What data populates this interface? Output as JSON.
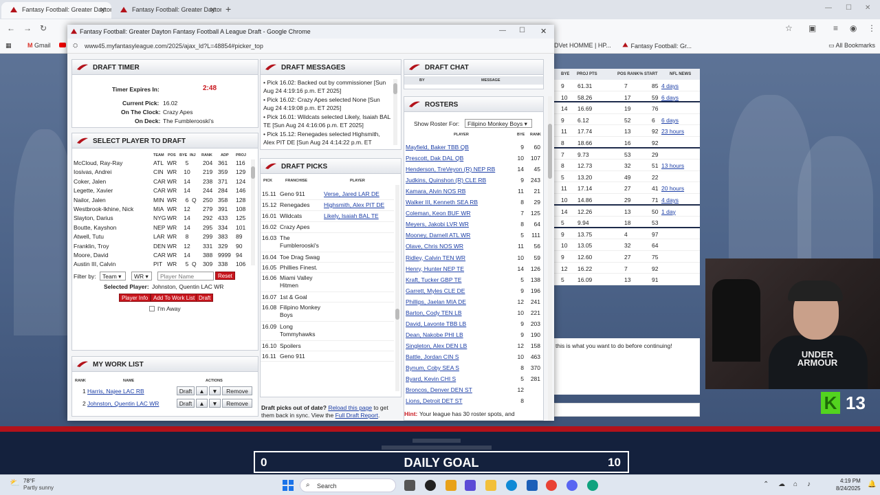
{
  "browser": {
    "tabs": [
      {
        "title": "Fantasy Football: Greater Dayton",
        "active": true
      },
      {
        "title": "Fantasy Football: Greater Dayton",
        "active": false
      }
    ],
    "bookmarks": [
      {
        "label": "Gmail"
      },
      {
        "label": "ADVet HOMME | HP..."
      },
      {
        "label": "Fantasy Football: Gr..."
      },
      {
        "label": "All Bookmarks"
      }
    ]
  },
  "popup": {
    "title": "Fantasy Football: Greater Dayton Fantasy Football A League Draft - Google Chrome",
    "url": "www45.myfantasyleague.com/2025/ajax_ld?L=48854#picker_top"
  },
  "timer": {
    "header": "DRAFT TIMER",
    "expires_label": "Timer Expires In:",
    "expires_value": "2:48",
    "current_label": "Current Pick:",
    "current_value": "16.02",
    "clock_label": "On The Clock:",
    "clock_value": "Crazy Apes",
    "deck_label": "On Deck:",
    "deck_value": "The Fumblerooski's"
  },
  "select": {
    "header": "SELECT PLAYER TO DRAFT",
    "columns": [
      "TEAM",
      "POS",
      "BYE",
      "INJ",
      "RANK",
      "ADP",
      "PROJ"
    ],
    "rows": [
      {
        "name": "McCloud, Ray-Ray",
        "team": "ATL",
        "pos": "WR",
        "bye": "5",
        "inj": "",
        "rank": "204",
        "adp": "361",
        "proj": "116"
      },
      {
        "name": "Iosivas, Andrei",
        "team": "CIN",
        "pos": "WR",
        "bye": "10",
        "inj": "",
        "rank": "219",
        "adp": "359",
        "proj": "129"
      },
      {
        "name": "Coker, Jalen",
        "team": "CAR",
        "pos": "WR",
        "bye": "14",
        "inj": "",
        "rank": "238",
        "adp": "371",
        "proj": "124"
      },
      {
        "name": "Legette, Xavier",
        "team": "CAR",
        "pos": "WR",
        "bye": "14",
        "inj": "",
        "rank": "244",
        "adp": "284",
        "proj": "146"
      },
      {
        "name": "Nailor, Jalen",
        "team": "MIN",
        "pos": "WR",
        "bye": "6",
        "inj": "Q",
        "rank": "250",
        "adp": "358",
        "proj": "128"
      },
      {
        "name": "Westbrook-Ikhine, Nick",
        "team": "MIA",
        "pos": "WR",
        "bye": "12",
        "inj": "",
        "rank": "279",
        "adp": "391",
        "proj": "108"
      },
      {
        "name": "Slayton, Darius",
        "team": "NYG",
        "pos": "WR",
        "bye": "14",
        "inj": "",
        "rank": "292",
        "adp": "433",
        "proj": "125"
      },
      {
        "name": "Boutte, Kayshon",
        "team": "NEP",
        "pos": "WR",
        "bye": "14",
        "inj": "",
        "rank": "295",
        "adp": "334",
        "proj": "101"
      },
      {
        "name": "Atwell, Tutu",
        "team": "LAR",
        "pos": "WR",
        "bye": "8",
        "inj": "",
        "rank": "299",
        "adp": "383",
        "proj": "89"
      },
      {
        "name": "Franklin, Troy",
        "team": "DEN",
        "pos": "WR",
        "bye": "12",
        "inj": "",
        "rank": "331",
        "adp": "329",
        "proj": "90"
      },
      {
        "name": "Moore, David",
        "team": "CAR",
        "pos": "WR",
        "bye": "14",
        "inj": "",
        "rank": "388",
        "adp": "9999",
        "proj": "94"
      },
      {
        "name": "Austin III, Calvin",
        "team": "PIT",
        "pos": "WR",
        "bye": "5",
        "inj": "Q",
        "rank": "309",
        "adp": "338",
        "proj": "106"
      }
    ],
    "filter_label": "Filter by:",
    "filter_team": "Team",
    "filter_pos": "WR",
    "name_placeholder": "Player Name",
    "reset_label": "Reset",
    "selected_label": "Selected Player:",
    "selected_value": "Johnston, Quentin LAC WR",
    "btn_info": "Player Info",
    "btn_worklist": "Add To Work List",
    "btn_draft": "Draft",
    "away_label": "I'm Away"
  },
  "worklist": {
    "header": "MY WORK LIST",
    "col_rank": "RANK",
    "col_name": "NAME",
    "col_actions": "ACTIONS",
    "rows": [
      {
        "rank": "1",
        "name": "Harris, Najee LAC RB"
      },
      {
        "rank": "2",
        "name": "Johnston, Quentin LAC WR"
      }
    ],
    "draft_label": "Draft",
    "up_label": "▲",
    "down_label": "▼",
    "remove_label": "Remove"
  },
  "messages": {
    "header": "DRAFT MESSAGES",
    "items": [
      "Pick 16.02: Backed out by commissioner [Sun Aug 24 4:19:16 p.m. ET 2025]",
      "Pick 16.02: Crazy Apes selected None [Sun Aug 24 4:19:08 p.m. ET 2025]",
      "Pick 16.01: Wildcats selected Likely, Isaiah BAL TE [Sun Aug 24 4:16:06 p.m. ET 2025]",
      "Pick 15.12: Renegades selected Highsmith, Alex PIT DE [Sun Aug 24 4:14:22 p.m. ET"
    ]
  },
  "picks": {
    "header": "DRAFT PICKS",
    "col_pick": "PICK",
    "col_franchise": "FRANCHISE",
    "col_player": "PLAYER",
    "rows": [
      {
        "pick": "15.11",
        "franchise": "Geno 911",
        "player": "Verse, Jared LAR DE",
        "h": 16
      },
      {
        "pick": "15.12",
        "franchise": "Renegades",
        "player": "Highsmith, Alex PIT DE",
        "h": 16
      },
      {
        "pick": "16.01",
        "franchise": "Wildcats",
        "player": "Likely, Isaiah BAL TE",
        "h": 16
      },
      {
        "pick": "16.02",
        "franchise": "Crazy Apes",
        "player": "",
        "h": 16
      },
      {
        "pick": "16.03",
        "franchise": "The Fumblerooski's",
        "player": "",
        "h": 28
      },
      {
        "pick": "16.04",
        "franchise": "Toe Drag Swag",
        "player": "",
        "h": 15
      },
      {
        "pick": "16.05",
        "franchise": "Phillies Finest.",
        "player": "",
        "h": 15
      },
      {
        "pick": "16.06",
        "franchise": "Miami Valley Hitmen",
        "player": "",
        "h": 28
      },
      {
        "pick": "16.07",
        "franchise": "1st & Goal",
        "player": "",
        "h": 15
      },
      {
        "pick": "16.08",
        "franchise": "Filipino Monkey Boys",
        "player": "",
        "h": 28
      },
      {
        "pick": "16.09",
        "franchise": "Long Tommyhawks",
        "player": "",
        "h": 28
      },
      {
        "pick": "16.10",
        "franchise": "Spoilers",
        "player": "",
        "h": 15
      },
      {
        "pick": "16.11",
        "franchise": "Geno 911",
        "player": "",
        "h": 15
      }
    ],
    "note_prefix": "Draft picks out of date?",
    "note_link1": "Reload this page",
    "note_mid": "to get them back in sync. View the",
    "note_link2": "Full Draft Report",
    "note_end": "."
  },
  "chat": {
    "header": "DRAFT CHAT",
    "col_by": "BY",
    "col_message": "MESSAGE"
  },
  "rosters": {
    "header": "ROSTERS",
    "show_label": "Show Roster For:",
    "selected_team": "Filipino Monkey Boys",
    "col_player": "PLAYER",
    "col_bye": "BYE",
    "col_rank": "RANK",
    "rows": [
      {
        "player": "Mayfield, Baker TBB QB",
        "bye": "9",
        "rank": "60"
      },
      {
        "player": "Prescott, Dak DAL QB",
        "bye": "10",
        "rank": "107"
      },
      {
        "player": "Henderson, TreVeyon (R) NEP RB",
        "bye": "14",
        "rank": "45"
      },
      {
        "player": "Judkins, Quinshon (R) CLE RB",
        "bye": "9",
        "rank": "243"
      },
      {
        "player": "Kamara, Alvin NOS RB",
        "bye": "11",
        "rank": "21"
      },
      {
        "player": "Walker III, Kenneth SEA RB",
        "bye": "8",
        "rank": "29"
      },
      {
        "player": "Coleman, Keon BUF WR",
        "bye": "7",
        "rank": "125"
      },
      {
        "player": "Meyers, Jakobi LVR WR",
        "bye": "8",
        "rank": "64"
      },
      {
        "player": "Mooney, Darnell ATL WR",
        "bye": "5",
        "rank": "111"
      },
      {
        "player": "Olave, Chris NOS WR",
        "bye": "11",
        "rank": "56"
      },
      {
        "player": "Ridley, Calvin TEN WR",
        "bye": "10",
        "rank": "59"
      },
      {
        "player": "Henry, Hunter NEP TE",
        "bye": "14",
        "rank": "126"
      },
      {
        "player": "Kraft, Tucker GBP TE",
        "bye": "5",
        "rank": "138"
      },
      {
        "player": "Garrett, Myles CLE DE",
        "bye": "9",
        "rank": "196"
      },
      {
        "player": "Phillips, Jaelan MIA DE",
        "bye": "12",
        "rank": "241"
      },
      {
        "player": "Barton, Cody TEN LB",
        "bye": "10",
        "rank": "221"
      },
      {
        "player": "David, Lavonte TBB LB",
        "bye": "9",
        "rank": "203"
      },
      {
        "player": "Dean, Nakobe PHI LB",
        "bye": "9",
        "rank": "190"
      },
      {
        "player": "Singleton, Alex DEN LB",
        "bye": "12",
        "rank": "158"
      },
      {
        "player": "Battle, Jordan CIN S",
        "bye": "10",
        "rank": "463"
      },
      {
        "player": "Bynum, Coby SEA S",
        "bye": "8",
        "rank": "370"
      },
      {
        "player": "Byard, Kevin CHI S",
        "bye": "5",
        "rank": "281"
      },
      {
        "player": "Broncos, Denver DEN ST",
        "bye": "12",
        "rank": ""
      },
      {
        "player": "Lions, Detroit DET ST",
        "bye": "8",
        "rank": ""
      }
    ],
    "hint_label": "Hint:",
    "hint_text": "Your league has 30 roster spots, and"
  },
  "bg": {
    "columns": [
      "BYE",
      "PROJ PTS",
      "POS RANK",
      "% START",
      "NFL NEWS"
    ],
    "rows": [
      {
        "bye": "9",
        "proj": "61.31",
        "rank": "7",
        "start": "85",
        "news": "4 days",
        "sep": false
      },
      {
        "bye": "10",
        "proj": "58.26",
        "rank": "17",
        "start": "59",
        "news": "6 days",
        "sep": true
      },
      {
        "bye": "14",
        "proj": "16.69",
        "rank": "19",
        "start": "76",
        "news": "",
        "sep": false
      },
      {
        "bye": "9",
        "proj": "6.12",
        "rank": "52",
        "start": "6",
        "news": "6 days",
        "sep": false
      },
      {
        "bye": "11",
        "proj": "17.74",
        "rank": "13",
        "start": "92",
        "news": "23 hours",
        "sep": false
      },
      {
        "bye": "8",
        "proj": "18.66",
        "rank": "16",
        "start": "92",
        "news": "",
        "sep": true
      },
      {
        "bye": "7",
        "proj": "9.73",
        "rank": "53",
        "start": "29",
        "news": "",
        "sep": false
      },
      {
        "bye": "8",
        "proj": "12.73",
        "rank": "32",
        "start": "51",
        "news": "13 hours",
        "sep": false
      },
      {
        "bye": "5",
        "proj": "13.20",
        "rank": "49",
        "start": "22",
        "news": "",
        "sep": false
      },
      {
        "bye": "11",
        "proj": "17.14",
        "rank": "27",
        "start": "41",
        "news": "20 hours",
        "sep": false
      },
      {
        "bye": "10",
        "proj": "14.86",
        "rank": "29",
        "start": "71",
        "news": "4 days",
        "sep": true
      },
      {
        "bye": "14",
        "proj": "12.26",
        "rank": "13",
        "start": "50",
        "news": "1 day",
        "sep": false
      },
      {
        "bye": "5",
        "proj": "9.94",
        "rank": "18",
        "start": "53",
        "news": "",
        "sep": true
      },
      {
        "bye": "9",
        "proj": "13.75",
        "rank": "4",
        "start": "97",
        "news": "",
        "sep": false
      },
      {
        "bye": "10",
        "proj": "13.05",
        "rank": "32",
        "start": "64",
        "news": "",
        "sep": false
      },
      {
        "bye": "9",
        "proj": "12.60",
        "rank": "27",
        "start": "75",
        "news": "",
        "sep": false
      },
      {
        "bye": "12",
        "proj": "16.22",
        "rank": "7",
        "start": "92",
        "news": "",
        "sep": false
      },
      {
        "bye": "5",
        "proj": "16.09",
        "rank": "13",
        "start": "91",
        "news": "",
        "sep": false
      }
    ],
    "notice": "this is what you want to do before continuing!"
  },
  "overlay": {
    "k_letter": "K",
    "k_count": "13",
    "goal_left": "0",
    "goal_label": "DAILY GOAL",
    "goal_right": "10"
  },
  "taskbar": {
    "weather_temp": "78°F",
    "weather_desc": "Partly sunny",
    "search_label": "Search",
    "time": "4:19 PM",
    "date": "8/24/2025"
  },
  "colors": {
    "brand_red": "#c8161d",
    "link_blue": "#1a3da6",
    "navy": "#14213d"
  }
}
